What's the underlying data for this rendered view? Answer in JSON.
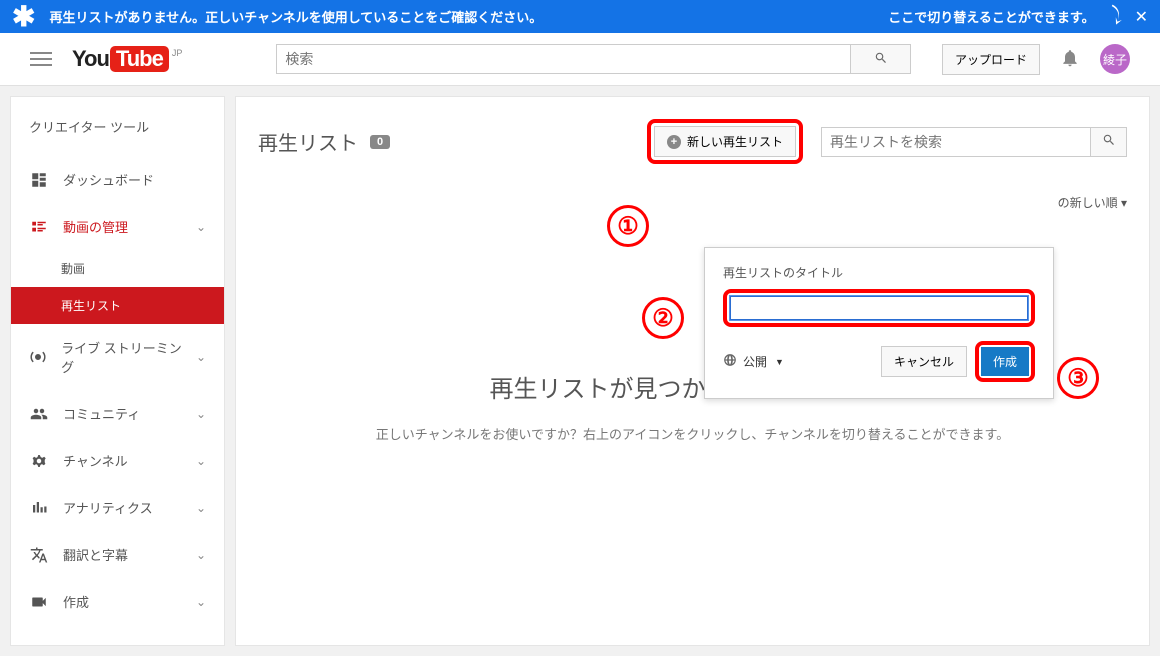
{
  "banner": {
    "message": "再生リストがありません。正しいチャンネルを使用していることをご確認ください。",
    "switch_text": "ここで切り替えることができます。"
  },
  "header": {
    "logo_you": "You",
    "logo_tube": "Tube",
    "logo_region": "JP",
    "search_placeholder": "検索",
    "upload_label": "アップロード",
    "avatar_text": "綾子"
  },
  "sidebar": {
    "title": "クリエイター ツール",
    "dashboard": "ダッシュボード",
    "video_manager": "動画の管理",
    "sub_video": "動画",
    "sub_playlist": "再生リスト",
    "live": "ライブ ストリーミング",
    "community": "コミュニティ",
    "channel": "チャンネル",
    "analytics": "アナリティクス",
    "translations": "翻訳と字幕",
    "create": "作成"
  },
  "main": {
    "title": "再生リスト",
    "count": "0",
    "new_playlist_label": "新しい再生リスト",
    "playlist_search_placeholder": "再生リストを検索",
    "sort_label": "の新しい順 ▾",
    "empty_heading": "再生リストが見つかりませんでした。",
    "empty_sub": "正しいチャンネルをお使いですか？右上のアイコンをクリックし、チャンネルを切り替えることができます。"
  },
  "popup": {
    "title_label": "再生リストのタイトル",
    "visibility_label": "公開",
    "cancel_label": "キャンセル",
    "create_label": "作成"
  },
  "annotations": {
    "one": "①",
    "two": "②",
    "three": "③"
  }
}
